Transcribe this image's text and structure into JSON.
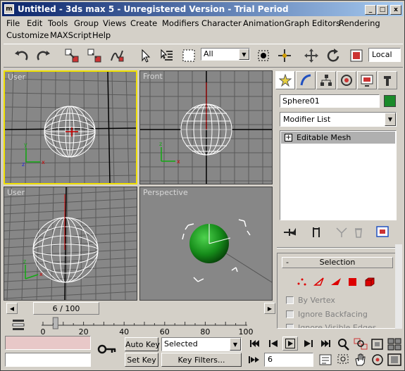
{
  "window": {
    "title": "Untitled - 3ds max 5 - Unregistered Version - Trial Period",
    "controls": {
      "minimize": "_",
      "maximize": "□",
      "close": "x"
    }
  },
  "menu": {
    "row1": [
      "File",
      "Edit",
      "Tools",
      "Group",
      "Views",
      "Create",
      "Modifiers",
      "Character",
      "Animation",
      "Graph Editors",
      "Rendering"
    ],
    "row2": [
      "Customize",
      "MAXScript",
      "Help"
    ]
  },
  "toolbar": {
    "selection_filter": "All",
    "coord_system": "Local"
  },
  "viewports": {
    "top_left": "User",
    "top_right": "Front",
    "bottom_left": "User",
    "bottom_right": "Perspective"
  },
  "command_panel": {
    "object_name": "Sphere01",
    "object_color": "#1a8a2a",
    "modifier_list": "Modifier List",
    "stack_item": "Editable Mesh",
    "rollout_title": "Selection",
    "rollout_minus": "-",
    "checkboxes": [
      "By Vertex",
      "Ignore Backfacing",
      "Ignore Visible Edges"
    ]
  },
  "timeline": {
    "frame_display": "6 / 100",
    "current_frame": 6,
    "total_frames": 100,
    "ticks": [
      "0",
      "20",
      "40",
      "60",
      "80",
      "100"
    ]
  },
  "bottom": {
    "auto_key": "Auto Key",
    "set_key": "Set Key",
    "key_filter": "Selected",
    "key_filters_button": "Key Filters...",
    "frame_field": "6"
  }
}
